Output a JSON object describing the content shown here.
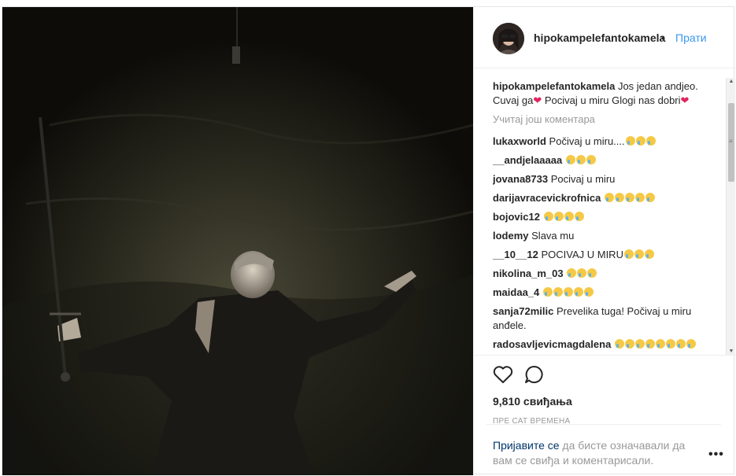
{
  "post": {
    "username": "hipokampelefantokamela",
    "dot": "•",
    "follow_label": "Прати",
    "caption": {
      "user": "hipokampelefantokamela",
      "text_part1": "Jos jedan andjeo. Cuvaj ga",
      "heart1": "❤",
      "text_part2": " Pocivaj u miru Glogi nas dobri",
      "heart2": "❤"
    },
    "load_more": "Учитај још коментара",
    "comments": [
      {
        "user": "lukaxworld",
        "text": "Počivaj u miru....",
        "emoji": 3
      },
      {
        "user": "__andjelaaaaa",
        "text": "",
        "emoji": 3
      },
      {
        "user": "jovana8733",
        "text": "Pocivaj u miru",
        "emoji": 0
      },
      {
        "user": "darijavracevickrofnica",
        "text": "",
        "emoji": 5
      },
      {
        "user": "bojovic12",
        "text": "",
        "emoji": 4
      },
      {
        "user": "lodemy",
        "text": "Slava mu",
        "emoji": 0
      },
      {
        "user": "__10__12",
        "text": "POCIVAJ U MIRU",
        "emoji": 3
      },
      {
        "user": "nikolina_m_03",
        "text": "",
        "emoji": 3
      },
      {
        "user": "maidaa_4",
        "text": "",
        "emoji": 5
      },
      {
        "user": "sanja72milic",
        "text": "Prevelika tuga! Počivaj u miru anđele.",
        "emoji": 0
      },
      {
        "user": "radosavljevicmagdalena",
        "text": "",
        "emoji": 8
      }
    ],
    "likes": "9,810 свиђања",
    "time": "ПРЕ САТ ВРЕМЕНА",
    "footer": {
      "login": "Пријавите се",
      "rest": " да бисте означавали да вам се свиђа и коментарисали."
    },
    "more_label": "•••",
    "scroll_up": "▲",
    "scroll_down": "▼",
    "grip": "≡"
  },
  "icons": {
    "like": "heart-outline-icon",
    "comment": "speech-bubble-icon",
    "more": "more-options-icon"
  },
  "colors": {
    "link": "#3897f0",
    "muted": "#999999",
    "heart": "#e0245e"
  }
}
